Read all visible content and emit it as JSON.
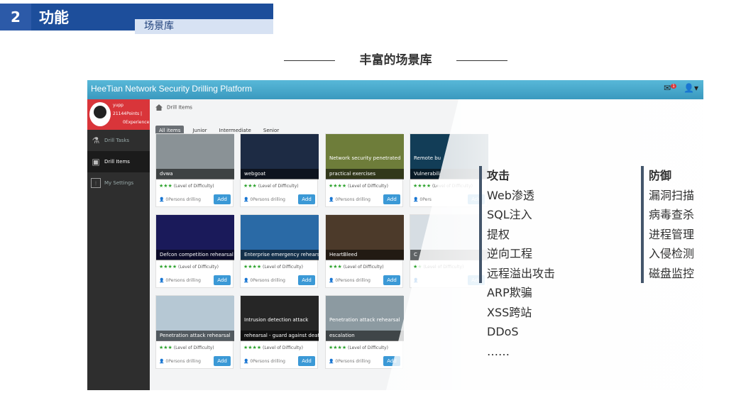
{
  "header": {
    "num": "2",
    "title": "功能",
    "subtitle": "场景库"
  },
  "section_title": "丰富的场景库",
  "app": {
    "title": "HeeTian Network Security Drilling Platform",
    "mail_badge": "1",
    "user": {
      "name": "yupp",
      "points": "21144Points |",
      "experience": "0Experience"
    },
    "sidebar": [
      {
        "label": "Drill Tasks",
        "icon": "flask-icon"
      },
      {
        "label": "Drill Items",
        "icon": "cube-icon"
      },
      {
        "label": "My Settings",
        "icon": "sliders-icon"
      }
    ],
    "breadcrumb": "Drill Items",
    "tabs": [
      "All items",
      "Junior",
      "Intermediate",
      "Senior"
    ],
    "cards": [
      {
        "caption": "dvwa",
        "img_text": "",
        "stars": "★★★",
        "people": "0Persons drilling",
        "color": "#8a9296"
      },
      {
        "caption": "webgoat",
        "img_text": "",
        "stars": "★★★",
        "people": "0Persons drilling",
        "color": "#1d2b44"
      },
      {
        "caption": "practical exercises",
        "img_text": "Network security penetrated",
        "stars": "★★★★",
        "people": "0Persons drilling",
        "color": "#6e7d3a"
      },
      {
        "caption": "Vulnerabili",
        "img_text": "Remote bu",
        "stars": "★★★★",
        "people": "0Pers",
        "color": "#123d57"
      },
      {
        "caption": "Defcon competition rehearsal",
        "img_text": "",
        "stars": "★★★★",
        "people": "0Persons drilling",
        "color": "#1a1a5a"
      },
      {
        "caption": "Enterprise emergency rehearsal",
        "img_text": "",
        "stars": "★★★★",
        "people": "0Persons drilling",
        "color": "#2a6aa6"
      },
      {
        "caption": "HeartBleed",
        "img_text": "",
        "stars": "★★★",
        "people": "0Persons drilling",
        "color": "#4c3a2a"
      },
      {
        "caption": "C",
        "img_text": "",
        "stars": "★★",
        "people": "",
        "color": "#d6dde3"
      },
      {
        "caption": "Penetration attack rehearsal",
        "img_text": "",
        "stars": "★★★",
        "people": "0Persons drilling",
        "color": "#b6c8d4"
      },
      {
        "caption": "rehearsal - guard against death",
        "img_text": "Intrusion detection attack",
        "stars": "★★★★",
        "people": "0Persons drilling",
        "color": "#262626"
      },
      {
        "caption": "escalation",
        "img_text": "Penetration attack rehearsal",
        "stars": "★★★★",
        "people": "0Persons drilling",
        "color": "#8c9aa1"
      }
    ],
    "level_text": "(Level of Difficulty)",
    "add_label": "Add"
  },
  "attack": {
    "title": "攻击",
    "items": [
      "Web渗透",
      "SQL注入",
      "提权",
      "逆向工程",
      "远程溢出攻击"
    ],
    "extra": [
      "ARP欺骗",
      "XSS跨站",
      "DDoS",
      "……"
    ]
  },
  "defense": {
    "title": "防御",
    "items": [
      "漏洞扫描",
      "病毒查杀",
      "进程管理",
      "入侵检测",
      "磁盘监控"
    ]
  }
}
